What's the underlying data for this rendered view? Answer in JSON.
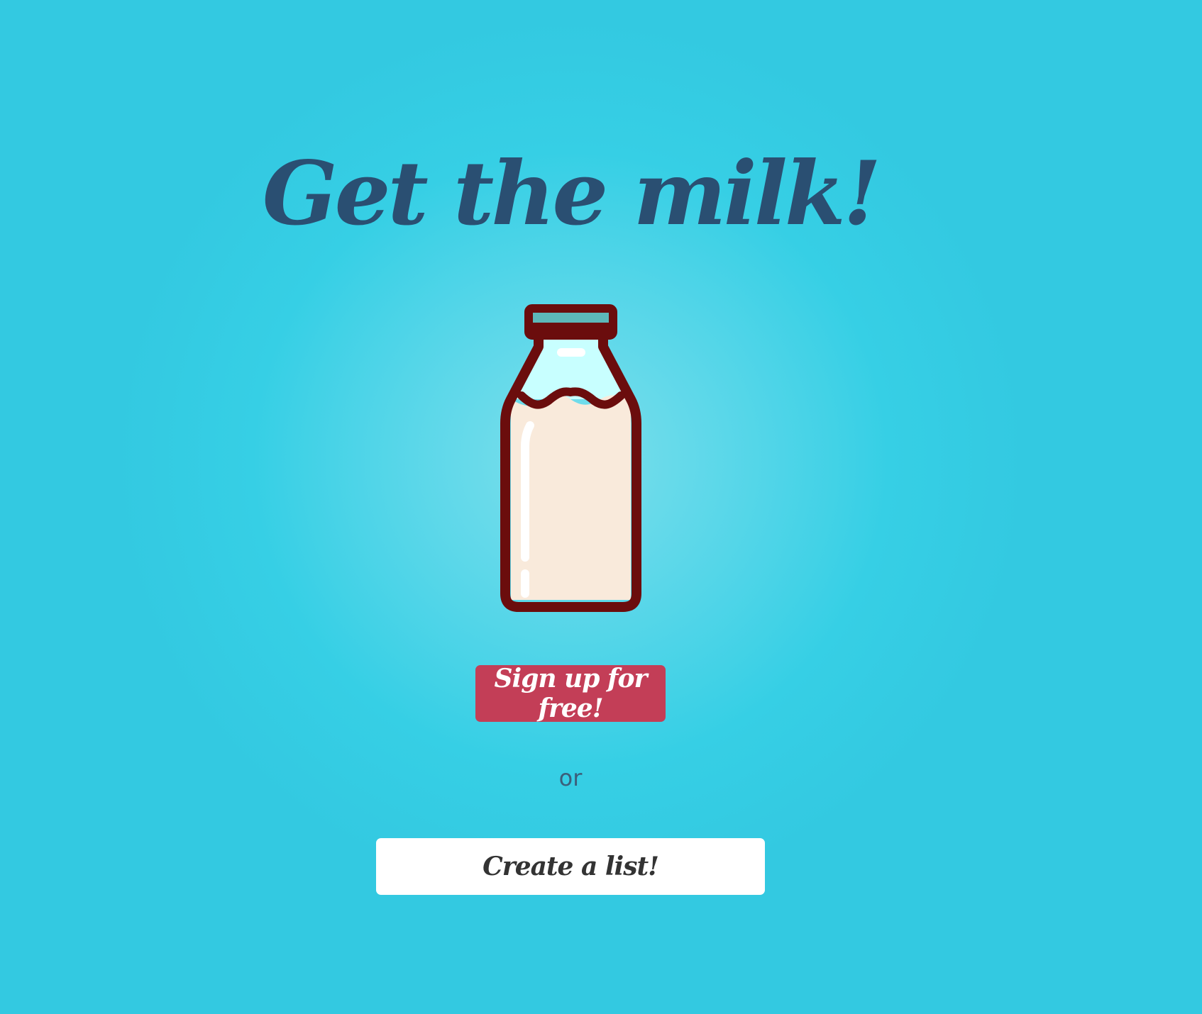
{
  "hero": {
    "title": "Get the milk!"
  },
  "illustration": {
    "icon": "milk-bottle-icon",
    "colors": {
      "outline": "#6b0d0d",
      "cap": "#5db8b9",
      "glass": "#c8ffff",
      "milk": "#f9eadb"
    }
  },
  "actions": {
    "signup_label": "Sign up for free!",
    "or_label": "or",
    "create_label": "Create a list!"
  },
  "colors": {
    "background": "#33c9e1",
    "title": "#2a4f72",
    "signup_button": "#c33e57",
    "create_button": "#ffffff"
  }
}
